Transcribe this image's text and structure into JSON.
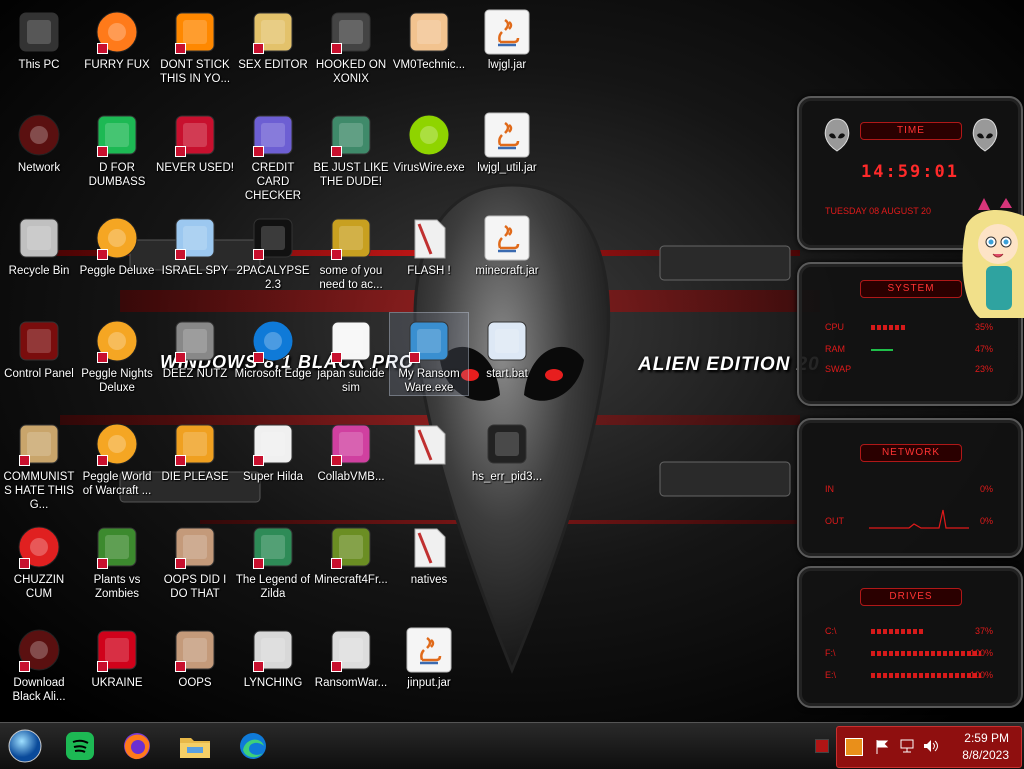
{
  "desktop": {
    "wallpaper_texts": {
      "left": "WINDOWS 8.1 BLACK PRO",
      "right": "ALIEN EDITION 20"
    },
    "icons": [
      {
        "label": "This PC",
        "icon": "this-pc-icon"
      },
      {
        "label": "Network",
        "icon": "network-icon"
      },
      {
        "label": "Recycle Bin",
        "icon": "recycle-bin-icon"
      },
      {
        "label": "Control Panel",
        "icon": "control-panel-icon"
      },
      {
        "label": "COMMUNISTS HATE THIS G...",
        "icon": "money-bag-icon"
      },
      {
        "label": "CHUZZIN CUM",
        "icon": "chuzzle-icon"
      },
      {
        "label": "Download Black Ali...",
        "icon": "alien-icon"
      },
      {
        "label": "FURRY FUX",
        "icon": "firefox-icon"
      },
      {
        "label": "D FOR DUMBASS",
        "icon": "spotify-icon"
      },
      {
        "label": "Peggle Deluxe",
        "icon": "peggle-icon"
      },
      {
        "label": "Peggle Nights Deluxe",
        "icon": "peggle-icon"
      },
      {
        "label": "Peggle World of Warcraft ...",
        "icon": "peggle-icon"
      },
      {
        "label": "Plants vs Zombies",
        "icon": "plants-icon"
      },
      {
        "label": "UKRAINE",
        "icon": "radiation-icon"
      },
      {
        "label": "DONT STICK THIS IN YO...",
        "icon": "vlc-cone-icon"
      },
      {
        "label": "NEVER USED!",
        "icon": "devcpp-icon"
      },
      {
        "label": "ISRAEL SPY",
        "icon": "network-cable-icon"
      },
      {
        "label": "DEEZ NUTZ",
        "icon": "stacked-windows-icon"
      },
      {
        "label": "DIE PLEASE",
        "icon": "de-icon"
      },
      {
        "label": "OOPS DID I DO THAT",
        "icon": "portrait-icon"
      },
      {
        "label": "OOPS",
        "icon": "portrait-icon"
      },
      {
        "label": "SEX EDITOR",
        "icon": "hxd-icon"
      },
      {
        "label": "CREDIT CARD CHECKER",
        "icon": "credit-card-icon"
      },
      {
        "label": "2PACALYPSE 2.3",
        "icon": "terminal-icon"
      },
      {
        "label": "Microsoft Edge",
        "icon": "edge-icon"
      },
      {
        "label": "Super Hilda",
        "icon": "pixel-dog-icon"
      },
      {
        "label": "The Legend of Zilda",
        "icon": "pixel-hero-icon"
      },
      {
        "label": "LYNCHING",
        "icon": "noose-icon"
      },
      {
        "label": "HOOKED ON XONIX",
        "icon": "xonix-icon"
      },
      {
        "label": "BE JUST LIKE THE DUDE!",
        "icon": "elf-icon"
      },
      {
        "label": "some of you need to ac...",
        "icon": "beaver-icon"
      },
      {
        "label": "japan suicide sim",
        "icon": "blocks-icon"
      },
      {
        "label": "CollabVMB...",
        "icon": "collab-icon"
      },
      {
        "label": "Minecraft4Fr...",
        "icon": "grass-block-icon"
      },
      {
        "label": "RansomWar...",
        "icon": "skull-icon"
      },
      {
        "label": "VM0Technic...",
        "icon": "doctor-icon"
      },
      {
        "label": "VirusWire.exe",
        "icon": "lime-icon"
      },
      {
        "label": "FLASH !",
        "icon": "folder-icon"
      },
      {
        "label": "My Ransom Ware.exe",
        "icon": "exe-window-icon"
      },
      {
        "label": "",
        "icon": "folder-icon"
      },
      {
        "label": "natives",
        "icon": "folder-icon"
      },
      {
        "label": "jinput.jar",
        "icon": "java-icon"
      },
      {
        "label": "lwjgl.jar",
        "icon": "java-icon"
      },
      {
        "label": "lwjgl_util.jar",
        "icon": "java-icon"
      },
      {
        "label": "minecraft.jar",
        "icon": "java-icon"
      },
      {
        "label": "start.bat",
        "icon": "gear-bat-icon"
      },
      {
        "label": "hs_err_pid3...",
        "icon": "text-file-icon"
      }
    ]
  },
  "widgets": {
    "time": {
      "title": "TIME",
      "clock": "14:59:01",
      "date": "TUESDAY 08 AUGUST 20"
    },
    "system": {
      "title": "SYSTEM",
      "rows": [
        {
          "k": "CPU",
          "v": "35%",
          "pct": 35
        },
        {
          "k": "RAM",
          "v": "47%",
          "pct": 47
        },
        {
          "k": "SWAP",
          "v": "23%",
          "pct": 23
        }
      ]
    },
    "network": {
      "title": "NETWORK",
      "rows": [
        {
          "k": "IN",
          "v": "0%"
        },
        {
          "k": "OUT",
          "v": "0%"
        }
      ]
    },
    "drives": {
      "title": "DRIVES",
      "rows": [
        {
          "k": "C:\\",
          "v": "37%",
          "pct": 37
        },
        {
          "k": "F:\\",
          "v": "100%",
          "pct": 100
        },
        {
          "k": "E:\\",
          "v": "100%",
          "pct": 100
        }
      ]
    }
  },
  "taskbar": {
    "apps": [
      {
        "name": "start-orb",
        "icon": "windows-orb-icon"
      },
      {
        "name": "spotify",
        "icon": "spotify-icon"
      },
      {
        "name": "firefox",
        "icon": "firefox-icon"
      },
      {
        "name": "file-explorer",
        "icon": "folder-icon"
      },
      {
        "name": "edge",
        "icon": "edge-icon"
      }
    ],
    "clock": {
      "time": "2:59 PM",
      "date": "8/8/2023"
    }
  },
  "colors": {
    "accent": "#d61a1a",
    "tray": "#8f0f0f"
  }
}
